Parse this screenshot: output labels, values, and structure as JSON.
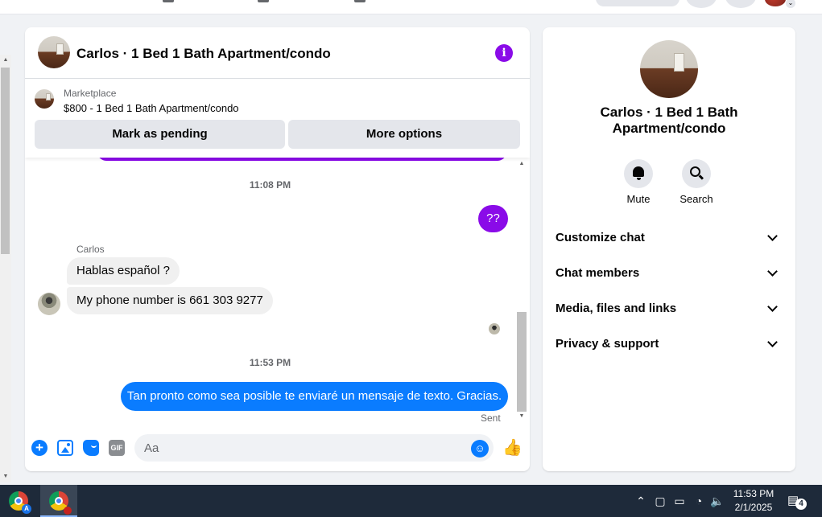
{
  "chat": {
    "title": "Carlos · 1 Bed 1 Bath Apartment/condo",
    "listing": {
      "label": "Marketplace",
      "price_title": "$800 - 1 Bed 1 Bath Apartment/condo",
      "mark_pending_label": "Mark as pending",
      "more_options_label": "More options"
    },
    "messages": {
      "timestamp1": "11:08 PM",
      "outgoing1": "??",
      "sender": "Carlos",
      "incoming1": "Hablas español ?",
      "incoming2": "My phone number is 661 303 9277",
      "timestamp2": "11:53 PM",
      "outgoing2": "Tan pronto como sea posible te enviaré un mensaje de texto. Gracias.",
      "status": "Sent"
    },
    "composer": {
      "placeholder": "Aa",
      "gif_label": "GIF"
    }
  },
  "info_panel": {
    "title": "Carlos · 1 Bed 1 Bath Apartment/condo",
    "actions": [
      {
        "label": "Mute",
        "icon": "bell-icon"
      },
      {
        "label": "Search",
        "icon": "magnifier-icon"
      }
    ],
    "sections": [
      "Customize chat",
      "Chat members",
      "Media, files and links",
      "Privacy & support"
    ]
  },
  "taskbar": {
    "time": "11:53 PM",
    "date": "2/1/2025",
    "notification_count": "4",
    "profile_badge": "A"
  },
  "colors": {
    "messenger_purple": "#8a0be8",
    "messenger_blue": "#0a7cff",
    "taskbar_bg": "#1e2a3a"
  }
}
